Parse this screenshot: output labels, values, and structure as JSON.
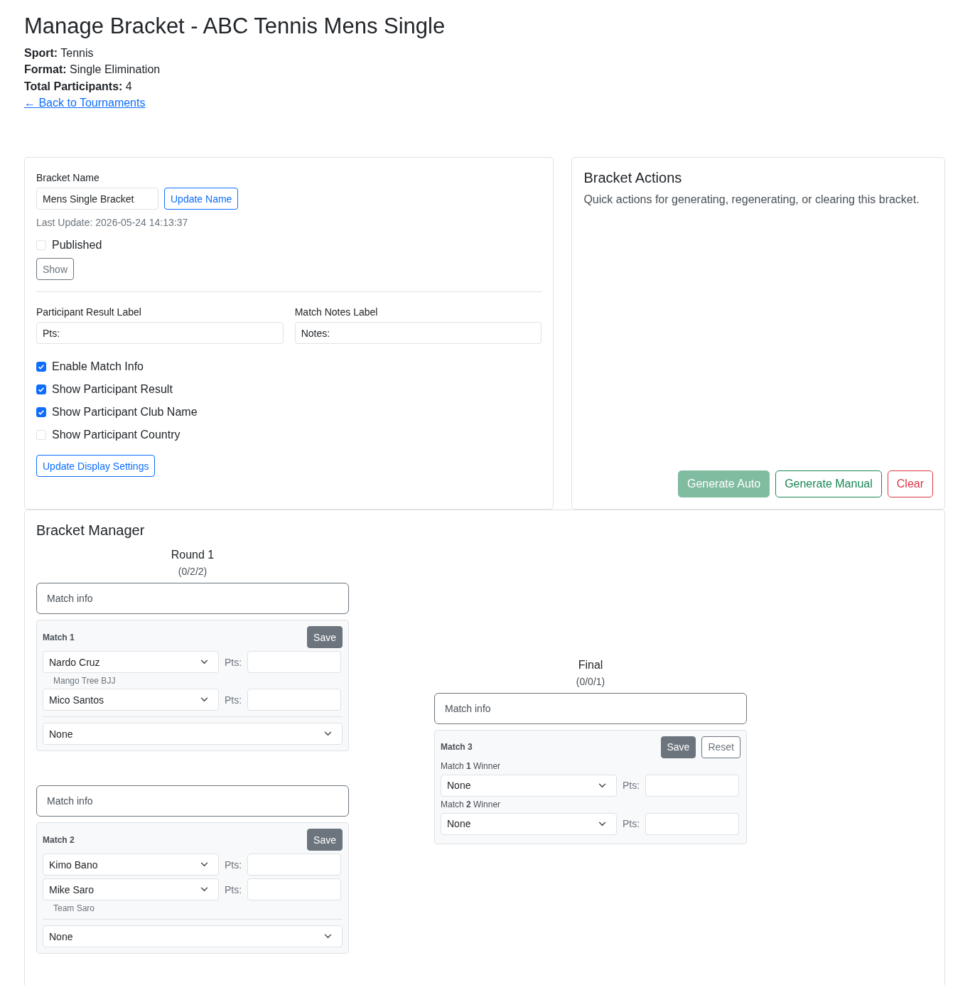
{
  "title": "Manage Bracket - ABC Tennis Mens Single",
  "details": [
    {
      "label": "Sport:",
      "value": "Tennis"
    },
    {
      "label": "Format:",
      "value": "Single Elimination"
    },
    {
      "label": "Total Participants:",
      "value": "4"
    }
  ],
  "back_link": "← Back to Tournaments",
  "settings": {
    "name_label": "Bracket Name",
    "name_value": "Mens Single Bracket",
    "update_name_button": "Update Name",
    "last_update": "Last Update: 2026-05-24 14:13:37",
    "published": {
      "label": "Published",
      "checked": false
    },
    "show_button": "Show",
    "fields": [
      {
        "label": "Participant Result Label",
        "value": "Pts:"
      },
      {
        "label": "Match Notes Label",
        "value": "Notes:"
      }
    ],
    "options": [
      {
        "label": "Enable Match Info",
        "checked": true
      },
      {
        "label": "Show Participant Result",
        "checked": true
      },
      {
        "label": "Show Participant Club Name",
        "checked": true
      },
      {
        "label": "Show Participant Country",
        "checked": false
      }
    ],
    "update_display_button": "Update Display Settings"
  },
  "actions": {
    "title": "Bracket Actions",
    "description": "Quick actions for generating, regenerating, or clearing this bracket.",
    "buttons": [
      {
        "label": "Generate Auto",
        "kind": "success",
        "disabled": true
      },
      {
        "label": "Generate Manual",
        "kind": "outline-success",
        "disabled": false
      },
      {
        "label": "Clear",
        "kind": "outline-danger",
        "disabled": false
      }
    ]
  },
  "manager": {
    "title": "Bracket Manager",
    "rounds": [
      {
        "title": "Round 1",
        "counts": "(0/2/2)",
        "matches": [
          {
            "info_placeholder": "Match info",
            "title": "Match 1",
            "buttons": [
              {
                "label": "Save",
                "kind": "secondary"
              }
            ],
            "slots": [
              {
                "value": "Nardo Cruz",
                "result_label": "Pts:",
                "club": "Mango Tree BJJ"
              },
              {
                "value": "Mico Santos",
                "result_label": "Pts:"
              }
            ],
            "winner": "None"
          },
          {
            "info_placeholder": "Match info",
            "title": "Match 2",
            "buttons": [
              {
                "label": "Save",
                "kind": "secondary"
              }
            ],
            "slots": [
              {
                "value": "Kimo Bano",
                "result_label": "Pts:"
              },
              {
                "value": "Mike Saro",
                "result_label": "Pts:",
                "club": "Team Saro"
              }
            ],
            "winner": "None"
          }
        ]
      },
      {
        "title": "Final",
        "counts": "(0/0/1)",
        "matches": [
          {
            "info_placeholder": "Match info",
            "title": "Match 3",
            "buttons": [
              {
                "label": "Save",
                "kind": "secondary"
              },
              {
                "label": "Reset",
                "kind": "outline-secondary"
              }
            ],
            "slots": [
              {
                "label": "Match **1** Winner",
                "value": "None",
                "result_label": "Pts:"
              },
              {
                "label": "Match **2** Winner",
                "value": "None",
                "result_label": "Pts:"
              }
            ]
          }
        ]
      }
    ]
  }
}
